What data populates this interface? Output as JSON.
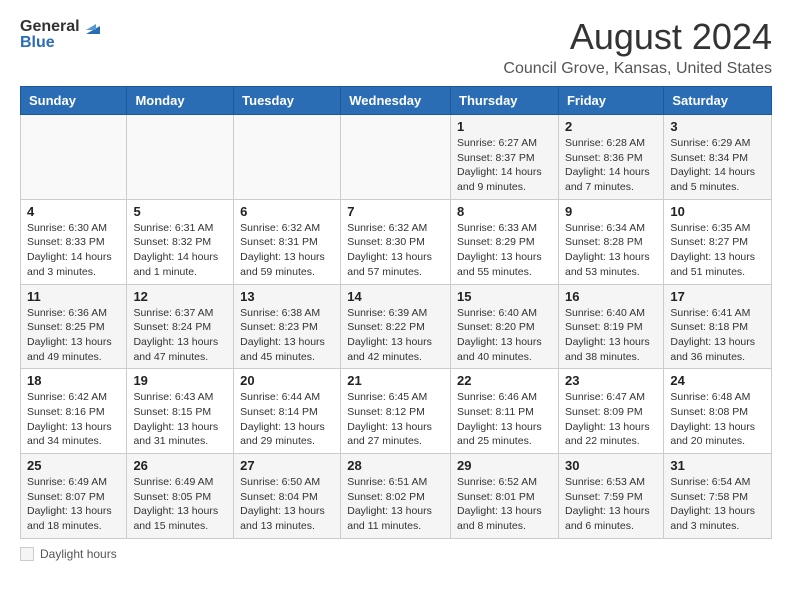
{
  "header": {
    "logo_general": "General",
    "logo_blue": "Blue",
    "month_title": "August 2024",
    "location": "Council Grove, Kansas, United States"
  },
  "days_of_week": [
    "Sunday",
    "Monday",
    "Tuesday",
    "Wednesday",
    "Thursday",
    "Friday",
    "Saturday"
  ],
  "legend_label": "Daylight hours",
  "weeks": [
    [
      {
        "day": "",
        "info": ""
      },
      {
        "day": "",
        "info": ""
      },
      {
        "day": "",
        "info": ""
      },
      {
        "day": "",
        "info": ""
      },
      {
        "day": "1",
        "info": "Sunrise: 6:27 AM\nSunset: 8:37 PM\nDaylight: 14 hours and 9 minutes."
      },
      {
        "day": "2",
        "info": "Sunrise: 6:28 AM\nSunset: 8:36 PM\nDaylight: 14 hours and 7 minutes."
      },
      {
        "day": "3",
        "info": "Sunrise: 6:29 AM\nSunset: 8:34 PM\nDaylight: 14 hours and 5 minutes."
      }
    ],
    [
      {
        "day": "4",
        "info": "Sunrise: 6:30 AM\nSunset: 8:33 PM\nDaylight: 14 hours and 3 minutes."
      },
      {
        "day": "5",
        "info": "Sunrise: 6:31 AM\nSunset: 8:32 PM\nDaylight: 14 hours and 1 minute."
      },
      {
        "day": "6",
        "info": "Sunrise: 6:32 AM\nSunset: 8:31 PM\nDaylight: 13 hours and 59 minutes."
      },
      {
        "day": "7",
        "info": "Sunrise: 6:32 AM\nSunset: 8:30 PM\nDaylight: 13 hours and 57 minutes."
      },
      {
        "day": "8",
        "info": "Sunrise: 6:33 AM\nSunset: 8:29 PM\nDaylight: 13 hours and 55 minutes."
      },
      {
        "day": "9",
        "info": "Sunrise: 6:34 AM\nSunset: 8:28 PM\nDaylight: 13 hours and 53 minutes."
      },
      {
        "day": "10",
        "info": "Sunrise: 6:35 AM\nSunset: 8:27 PM\nDaylight: 13 hours and 51 minutes."
      }
    ],
    [
      {
        "day": "11",
        "info": "Sunrise: 6:36 AM\nSunset: 8:25 PM\nDaylight: 13 hours and 49 minutes."
      },
      {
        "day": "12",
        "info": "Sunrise: 6:37 AM\nSunset: 8:24 PM\nDaylight: 13 hours and 47 minutes."
      },
      {
        "day": "13",
        "info": "Sunrise: 6:38 AM\nSunset: 8:23 PM\nDaylight: 13 hours and 45 minutes."
      },
      {
        "day": "14",
        "info": "Sunrise: 6:39 AM\nSunset: 8:22 PM\nDaylight: 13 hours and 42 minutes."
      },
      {
        "day": "15",
        "info": "Sunrise: 6:40 AM\nSunset: 8:20 PM\nDaylight: 13 hours and 40 minutes."
      },
      {
        "day": "16",
        "info": "Sunrise: 6:40 AM\nSunset: 8:19 PM\nDaylight: 13 hours and 38 minutes."
      },
      {
        "day": "17",
        "info": "Sunrise: 6:41 AM\nSunset: 8:18 PM\nDaylight: 13 hours and 36 minutes."
      }
    ],
    [
      {
        "day": "18",
        "info": "Sunrise: 6:42 AM\nSunset: 8:16 PM\nDaylight: 13 hours and 34 minutes."
      },
      {
        "day": "19",
        "info": "Sunrise: 6:43 AM\nSunset: 8:15 PM\nDaylight: 13 hours and 31 minutes."
      },
      {
        "day": "20",
        "info": "Sunrise: 6:44 AM\nSunset: 8:14 PM\nDaylight: 13 hours and 29 minutes."
      },
      {
        "day": "21",
        "info": "Sunrise: 6:45 AM\nSunset: 8:12 PM\nDaylight: 13 hours and 27 minutes."
      },
      {
        "day": "22",
        "info": "Sunrise: 6:46 AM\nSunset: 8:11 PM\nDaylight: 13 hours and 25 minutes."
      },
      {
        "day": "23",
        "info": "Sunrise: 6:47 AM\nSunset: 8:09 PM\nDaylight: 13 hours and 22 minutes."
      },
      {
        "day": "24",
        "info": "Sunrise: 6:48 AM\nSunset: 8:08 PM\nDaylight: 13 hours and 20 minutes."
      }
    ],
    [
      {
        "day": "25",
        "info": "Sunrise: 6:49 AM\nSunset: 8:07 PM\nDaylight: 13 hours and 18 minutes."
      },
      {
        "day": "26",
        "info": "Sunrise: 6:49 AM\nSunset: 8:05 PM\nDaylight: 13 hours and 15 minutes."
      },
      {
        "day": "27",
        "info": "Sunrise: 6:50 AM\nSunset: 8:04 PM\nDaylight: 13 hours and 13 minutes."
      },
      {
        "day": "28",
        "info": "Sunrise: 6:51 AM\nSunset: 8:02 PM\nDaylight: 13 hours and 11 minutes."
      },
      {
        "day": "29",
        "info": "Sunrise: 6:52 AM\nSunset: 8:01 PM\nDaylight: 13 hours and 8 minutes."
      },
      {
        "day": "30",
        "info": "Sunrise: 6:53 AM\nSunset: 7:59 PM\nDaylight: 13 hours and 6 minutes."
      },
      {
        "day": "31",
        "info": "Sunrise: 6:54 AM\nSunset: 7:58 PM\nDaylight: 13 hours and 3 minutes."
      }
    ]
  ]
}
